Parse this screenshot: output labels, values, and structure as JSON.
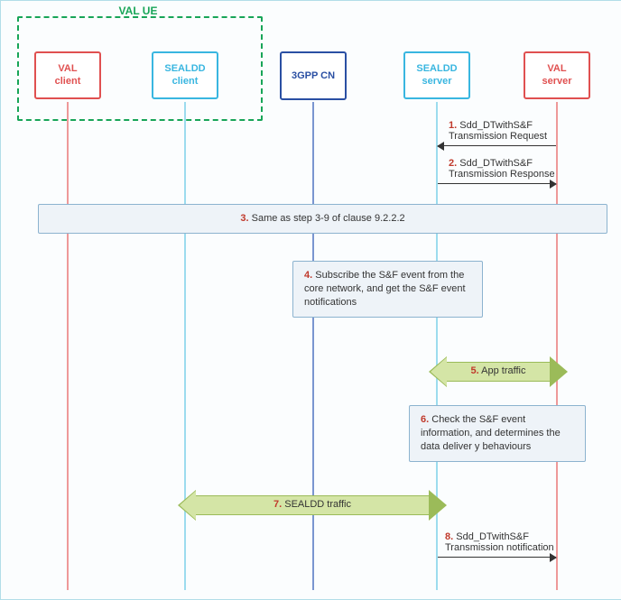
{
  "group_label": "VAL UE",
  "participants": {
    "val_client": "VAL\nclient",
    "sealdd_client": "SEALDD\nclient",
    "cn": "3GPP CN",
    "sealdd_server": "SEALDD\nserver",
    "val_server": "VAL\nserver"
  },
  "messages": {
    "m1": {
      "num": "1.",
      "text": "Sdd_DTwithS&F Transmission Request"
    },
    "m2": {
      "num": "2.",
      "text": "Sdd_DTwithS&F Transmission Response"
    },
    "m8": {
      "num": "8.",
      "text": "Sdd_DTwithS&F Transmission notification"
    }
  },
  "notes": {
    "n3": {
      "num": "3.",
      "text": "Same as step 3-9 of clause 9.2.2.2"
    },
    "n4": {
      "num": "4.",
      "text": "Subscribe the S&F event from the core network, and get the S&F event notifications"
    },
    "n6": {
      "num": "6.",
      "text": "Check the S&F event information, and determines the data deliver y behaviours"
    }
  },
  "fat_arrows": {
    "a5": {
      "num": "5.",
      "text": "App traffic"
    },
    "a7": {
      "num": "7.",
      "text": "SEALDD traffic"
    }
  }
}
